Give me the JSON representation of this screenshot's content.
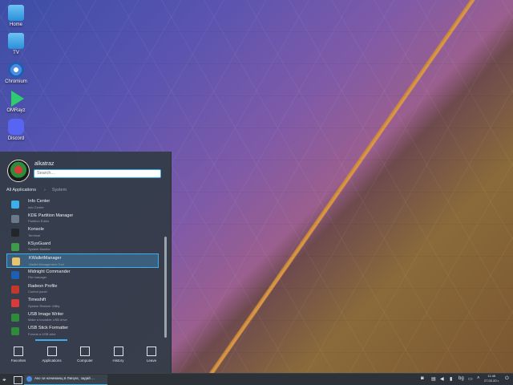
{
  "desktop": {
    "icons": [
      {
        "label": "Home",
        "icon": "folder-home-icon"
      },
      {
        "label": "TV",
        "icon": "folder-icon"
      },
      {
        "label": "Chromium",
        "icon": "chromium-icon"
      },
      {
        "label": "OMRayz",
        "icon": "play-icon"
      },
      {
        "label": "Discord",
        "icon": "discord-icon"
      }
    ]
  },
  "launcher": {
    "username": "alkatraz",
    "search_placeholder": "Search...",
    "breadcrumb": {
      "all": "All Applications",
      "current": "System"
    },
    "apps": [
      {
        "name": "Info Center",
        "desc": "Info Center",
        "color": "#3daee9"
      },
      {
        "name": "KDE Partition Manager",
        "desc": "Partition Editor",
        "color": "#6a7a8a"
      },
      {
        "name": "Konsole",
        "desc": "Terminal",
        "color": "#232629"
      },
      {
        "name": "KSysGuard",
        "desc": "System Monitor",
        "color": "#3f9b4a"
      },
      {
        "name": "KWalletManager",
        "desc": "Wallet Management Tool",
        "color": "#e9c46a"
      },
      {
        "name": "Midnight Commander",
        "desc": "File manager",
        "color": "#1d5fb3"
      },
      {
        "name": "Radeon Profile",
        "desc": "Control panel",
        "color": "#c0392b"
      },
      {
        "name": "Timeshift",
        "desc": "System Restore Utility",
        "color": "#d93b3b"
      },
      {
        "name": "USB Image Writer",
        "desc": "Make a bootable USB drive",
        "color": "#2e8b3a"
      },
      {
        "name": "USB Stick Formatter",
        "desc": "Format a USB stick",
        "color": "#2e8b3a"
      }
    ],
    "selected_index": 4,
    "nav": [
      {
        "label": "Favorites",
        "icon": "bookmark-icon"
      },
      {
        "label": "Applications",
        "icon": "grid-icon"
      },
      {
        "label": "Computer",
        "icon": "monitor-icon"
      },
      {
        "label": "History",
        "icon": "clock-icon"
      },
      {
        "label": "Leave",
        "icon": "leave-icon"
      }
    ]
  },
  "taskbar": {
    "task_title": "Ако си начинаещ в Линукс, задай ...",
    "tray_lang": "bg",
    "clock_time": "11:46",
    "clock_date": "27.02.20 г."
  }
}
